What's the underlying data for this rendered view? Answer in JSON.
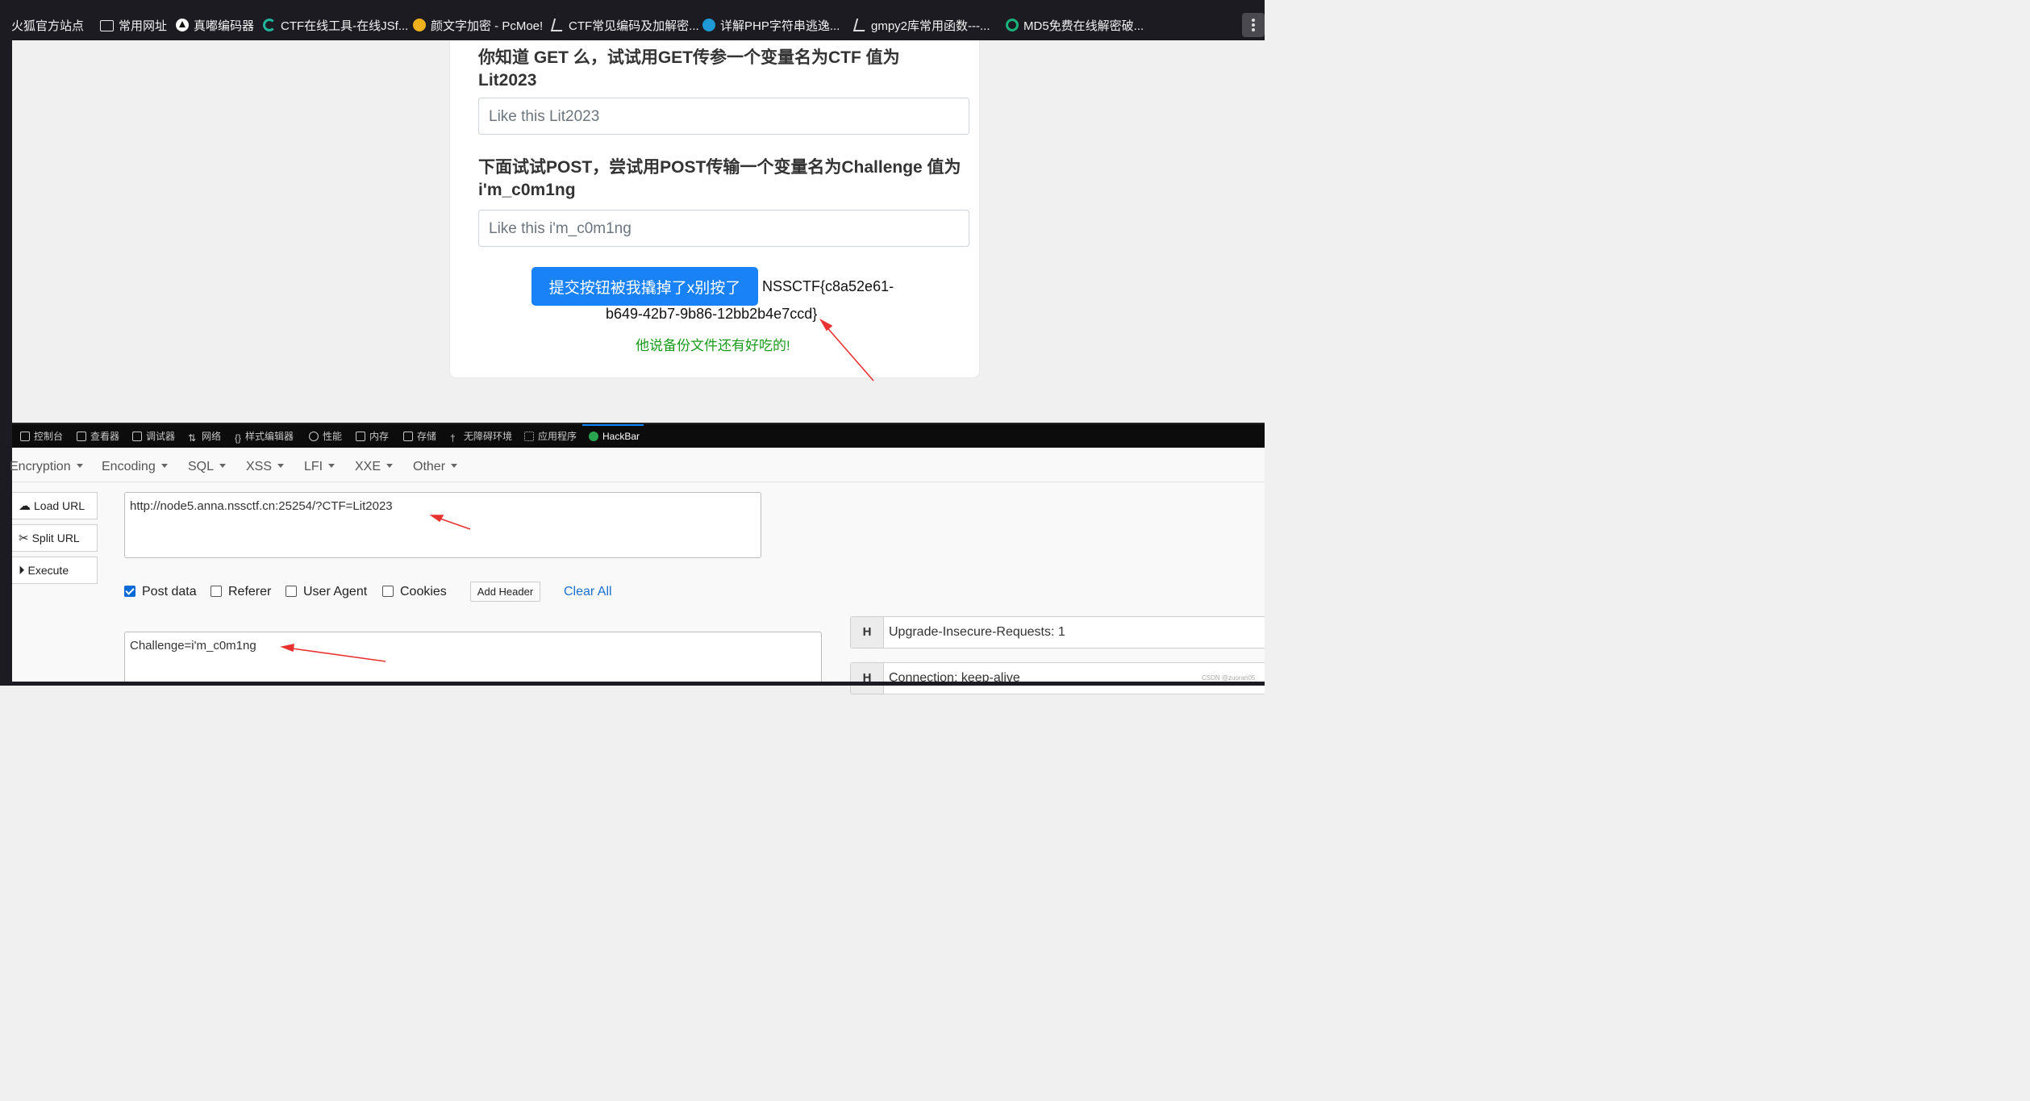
{
  "bookmarks": [
    {
      "label": "火狐官方站点",
      "icon": "firefox-icon"
    },
    {
      "label": "常用网址",
      "icon": "folder-icon"
    },
    {
      "label": "真嘟编码器",
      "icon": "triangle-icon"
    },
    {
      "label": "CTF在线工具-在线JSf...",
      "icon": "ctf-tool-icon"
    },
    {
      "label": "颜文字加密 - PcMoe!",
      "icon": "pcmoe-icon"
    },
    {
      "label": "CTF常见编码及加解密...",
      "icon": "csdn-icon"
    },
    {
      "label": "详解PHP字符串逃逸...",
      "icon": "edge-icon"
    },
    {
      "label": "gmpy2库常用函数---...",
      "icon": "csdn-icon"
    },
    {
      "label": "MD5免费在线解密破...",
      "icon": "md5-icon"
    }
  ],
  "page": {
    "get_question": "你知道 GET 么，试试用GET传参一个变量名为CTF 值为 Lit2023",
    "get_placeholder": "Like this Lit2023",
    "post_question": "下面试试POST，尝试用POST传输一个变量名为Challenge 值为 i'm_c0m1ng",
    "post_placeholder": "Like this i'm_c0m1ng",
    "submit_label": "提交按钮被我撬掉了x别按了",
    "flag_part1": "NSSCTF{c8a52e61-",
    "flag_part2": "b649-42b7-9b86-12bb2b4e7ccd}",
    "hint": "他说备份文件还有好吃的!"
  },
  "devtools_tabs": [
    "控制台",
    "查看器",
    "调试器",
    "网络",
    "样式编辑器",
    "性能",
    "内存",
    "存储",
    "无障碍环境",
    "应用程序",
    "HackBar"
  ],
  "hackbar": {
    "menus": [
      "Encryption",
      "Encoding",
      "SQL",
      "XSS",
      "LFI",
      "XXE",
      "Other"
    ],
    "load_url": "Load URL",
    "split_url": "Split URL",
    "execute": "Execute",
    "url_value": "http://node5.anna.nssctf.cn:25254/?CTF=Lit2023",
    "post_value": "Challenge=i'm_c0m1ng",
    "checkboxes": [
      {
        "label": "Post data",
        "checked": true
      },
      {
        "label": "Referer",
        "checked": false
      },
      {
        "label": "User Agent",
        "checked": false
      },
      {
        "label": "Cookies",
        "checked": false
      }
    ],
    "add_header": "Add Header",
    "clear_all": "Clear All",
    "headers": [
      {
        "key": "H",
        "value": "Upgrade-Insecure-Requests: 1"
      },
      {
        "key": "H",
        "value": "Connection: keep-alive"
      }
    ]
  },
  "watermark": "CSDN @zuoran05",
  "colors": {
    "accent": "#1a82f7",
    "hint": "#1a9a1a",
    "arrow": "#e83232"
  }
}
